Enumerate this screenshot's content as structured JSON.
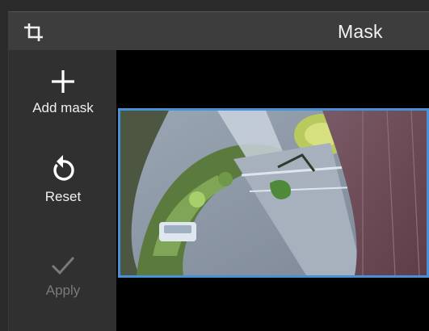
{
  "window": {
    "title": "Mask",
    "title_icon": "crop-icon"
  },
  "sidebar": {
    "tools": [
      {
        "id": "add-mask",
        "label": "Add mask",
        "icon": "plus-icon",
        "enabled": true
      },
      {
        "id": "reset",
        "label": "Reset",
        "icon": "reset-icon",
        "enabled": true
      },
      {
        "id": "apply",
        "label": "Apply",
        "icon": "check-icon",
        "enabled": false
      }
    ]
  },
  "preview": {
    "selection_color": "#4a90d9"
  },
  "colors": {
    "titlebar": "#3d3d3d",
    "sidebar": "#303030",
    "canvas": "#000000",
    "disabled_text": "#7a7a7a"
  }
}
